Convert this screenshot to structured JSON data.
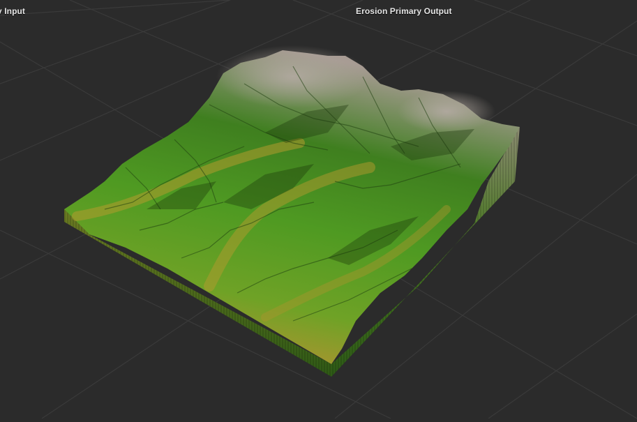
{
  "viewport": {
    "left_label": "y Input",
    "right_label": "Erosion Primary Output"
  },
  "scene": {
    "background_color": "#2b2b2b",
    "grid_color": "#3a3a3a",
    "terrain_colors": {
      "valley": "#a7952f",
      "lowland": "#4f9a22",
      "midland": "#3f7f1f",
      "peak": "#a69a92"
    }
  }
}
